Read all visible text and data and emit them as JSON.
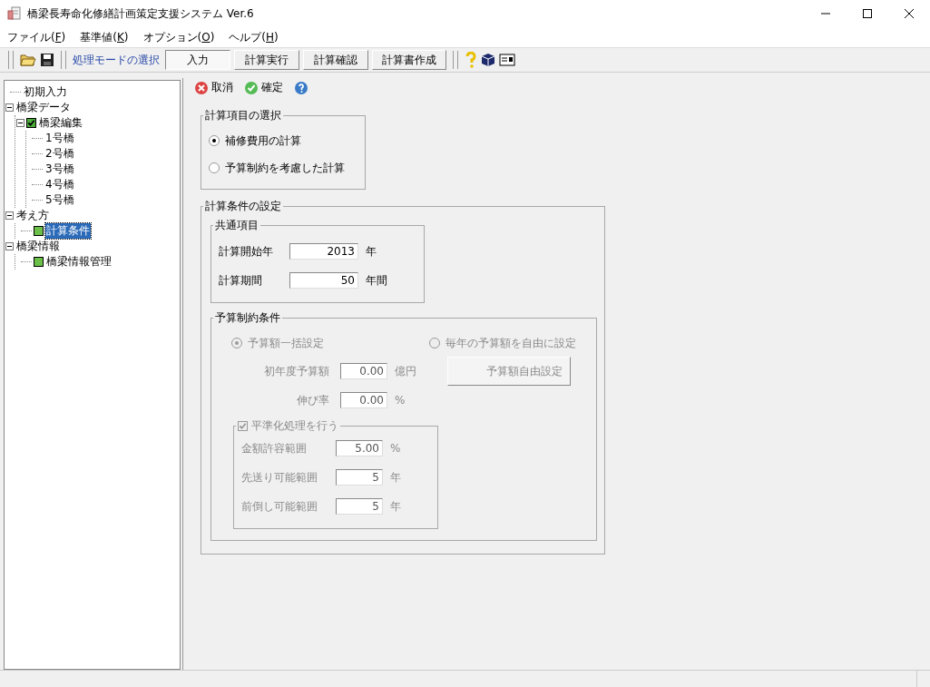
{
  "window": {
    "title": "橋梁長寿命化修繕計画策定支援システム Ver.6"
  },
  "menu": [
    {
      "before": "ファイル(",
      "accel": "F",
      "after": ")"
    },
    {
      "before": "基準値(",
      "accel": "K",
      "after": ")"
    },
    {
      "before": "オプション(",
      "accel": "O",
      "after": ")"
    },
    {
      "before": "ヘルプ(",
      "accel": "H",
      "after": ")"
    }
  ],
  "toolbar": {
    "mode_label": "処理モードの選択",
    "modes": [
      {
        "label": "入力",
        "selected": true
      },
      {
        "label": "計算実行",
        "selected": false
      },
      {
        "label": "計算確認",
        "selected": false
      },
      {
        "label": "計算書作成",
        "selected": false
      }
    ]
  },
  "tree": [
    {
      "label": "初期入力",
      "kind": "text",
      "selected": false
    },
    {
      "label": "橋梁データ",
      "kind": "text",
      "selected": false,
      "expanded": true,
      "children": [
        {
          "label": "橋梁編集",
          "kind": "check",
          "checked": true,
          "selected": false,
          "expanded": true,
          "children": [
            {
              "label": "1号橋",
              "kind": "text",
              "selected": false
            },
            {
              "label": "2号橋",
              "kind": "text",
              "selected": false
            },
            {
              "label": "3号橋",
              "kind": "text",
              "selected": false
            },
            {
              "label": "4号橋",
              "kind": "text",
              "selected": false
            },
            {
              "label": "5号橋",
              "kind": "text",
              "selected": false
            }
          ]
        }
      ]
    },
    {
      "label": "考え方",
      "kind": "text",
      "selected": false,
      "expanded": true,
      "children": [
        {
          "label": "計算条件",
          "kind": "page",
          "selected": true
        }
      ]
    },
    {
      "label": "橋梁情報",
      "kind": "text",
      "selected": false,
      "expanded": true,
      "children": [
        {
          "label": "橋梁情報管理",
          "kind": "page",
          "selected": false
        }
      ]
    }
  ],
  "actions": [
    {
      "kind": "cancel",
      "label": "取消"
    },
    {
      "kind": "ok",
      "label": "確定"
    },
    {
      "kind": "help"
    }
  ],
  "calc_items": {
    "title": "計算項目の選択",
    "options": [
      {
        "label": "補修費用の計算",
        "selected": true
      },
      {
        "label": "予算制約を考慮した計算",
        "selected": false
      }
    ]
  },
  "conditions": {
    "title": "計算条件の設定",
    "common": {
      "title": "共通項目",
      "fields": [
        {
          "label": "計算開始年",
          "value": "2013",
          "unit": "年"
        },
        {
          "label": "計算期間",
          "value": "50",
          "unit": "年間"
        }
      ]
    },
    "budget": {
      "title": "予算制約条件",
      "disabled": true,
      "modes": [
        {
          "label": "予算額一括設定",
          "selected": true
        },
        {
          "label": "毎年の予算額を自由に設定",
          "selected": false
        }
      ],
      "fields": [
        {
          "label": "初年度予算額",
          "value": "0.00",
          "unit": "億円"
        },
        {
          "label": "伸び率",
          "value": "0.00",
          "unit": "%"
        }
      ],
      "free_button": "予算額自由設定",
      "smoothing": {
        "label": "平準化処理を行う",
        "checked": true,
        "fields": [
          {
            "label": "金額許容範囲",
            "value": "5.00",
            "unit": "%"
          },
          {
            "label": "先送り可能範囲",
            "value": "5",
            "unit": "年"
          },
          {
            "label": "前倒し可能範囲",
            "value": "5",
            "unit": "年"
          }
        ]
      }
    }
  }
}
